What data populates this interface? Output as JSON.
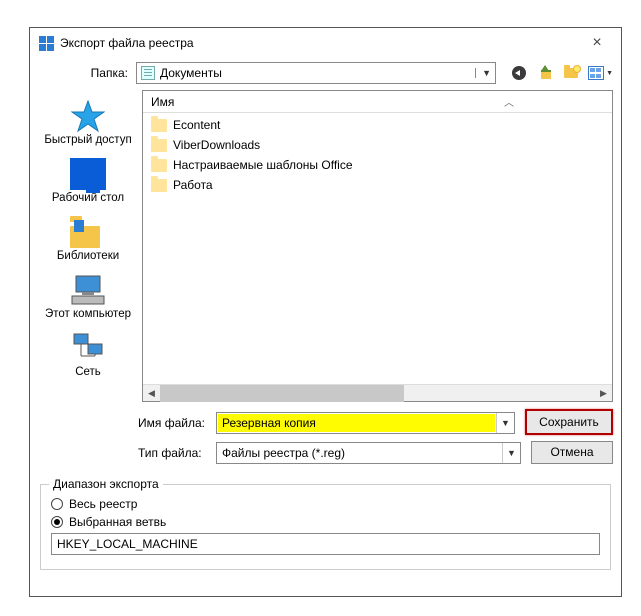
{
  "window": {
    "title": "Экспорт файла реестра"
  },
  "toprow": {
    "folder_label": "Папка:",
    "selected_folder": "Документы"
  },
  "places": {
    "quick": "Быстрый доступ",
    "desktop": "Рабочий стол",
    "libs": "Библиотеки",
    "pc": "Этот компьютер",
    "net": "Сеть"
  },
  "list": {
    "header": "Имя",
    "items": [
      {
        "name": "Econtent"
      },
      {
        "name": "ViberDownloads"
      },
      {
        "name": "Настраиваемые шаблоны Office"
      },
      {
        "name": "Работа"
      }
    ]
  },
  "form": {
    "filename_label": "Имя файла:",
    "filename_value": "Резервная копия",
    "filetype_label": "Тип файла:",
    "filetype_value": "Файлы реестра (*.reg)",
    "save": "Сохранить",
    "cancel": "Отмена"
  },
  "export": {
    "legend": "Диапазон экспорта",
    "all": "Весь реестр",
    "branch": "Выбранная ветвь",
    "branch_value": "HKEY_LOCAL_MACHINE"
  }
}
